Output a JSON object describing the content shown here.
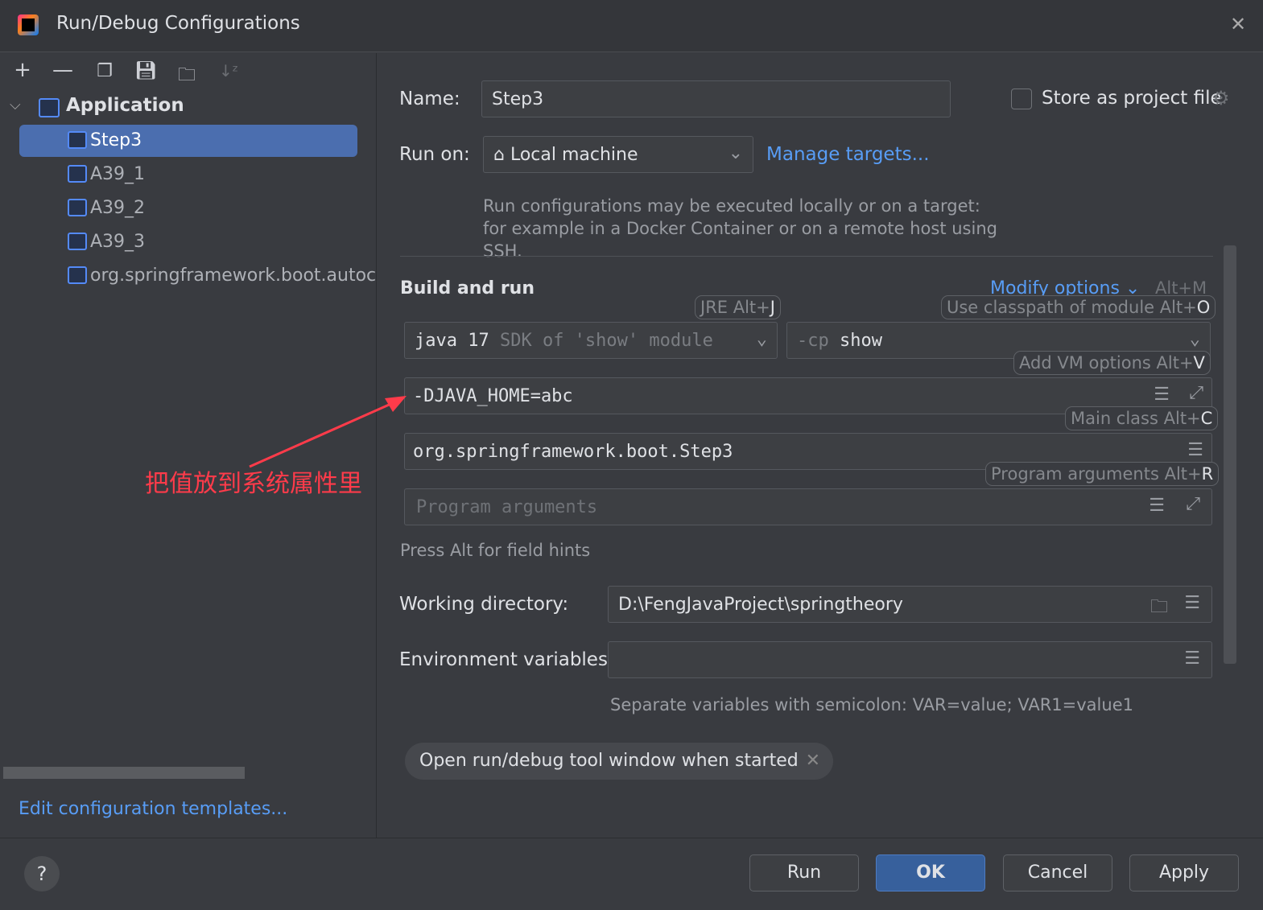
{
  "window": {
    "title": "Run/Debug Configurations",
    "close_icon": "close-icon"
  },
  "toolbar": {
    "icons": [
      "add-icon",
      "remove-icon",
      "copy-icon",
      "save-icon",
      "new-folder-icon",
      "sort-icon"
    ]
  },
  "tree": {
    "group": "Application",
    "items": [
      {
        "label": "Step3",
        "selected": true
      },
      {
        "label": "A39_1"
      },
      {
        "label": "A39_2"
      },
      {
        "label": "A39_3"
      },
      {
        "label": "org.springframework.boot.autoco"
      }
    ]
  },
  "edit_templates": "Edit configuration templates...",
  "form": {
    "name_label": "Name:",
    "name_value": "Step3",
    "store_label": "Store as project file",
    "run_on_label": "Run on:",
    "run_on_value": "Local machine",
    "manage_targets": "Manage targets...",
    "run_on_help": "Run configurations may be executed locally or on a target: for example in a Docker Container or on a remote host using SSH.",
    "section": "Build and run",
    "modify_options": "Modify options",
    "modify_shortcut": "Alt+M",
    "jre_value": "java 17",
    "jre_hint": "SDK of 'show' module",
    "cp_prefix": "-cp",
    "cp_value": "show",
    "vm_options": "-DJAVA_HOME=abc",
    "main_class": "org.springframework.boot.Step3",
    "program_args_placeholder": "Program arguments",
    "alt_hint": "Press Alt for field hints",
    "workdir_label": "Working directory:",
    "workdir_value": "D:\\FengJavaProject\\springtheory",
    "env_label": "Environment variables:",
    "env_value": "",
    "env_help": "Separate variables with semicolon: VAR=value; VAR1=value1",
    "chip": "Open run/debug tool window when started"
  },
  "pills": {
    "jre": [
      "JRE Alt+",
      "J"
    ],
    "cp": [
      "Use classpath of module Alt+",
      "O"
    ],
    "vm": [
      "Add VM options Alt+",
      "V"
    ],
    "main": [
      "Main class Alt+",
      "C"
    ],
    "args": [
      "Program arguments Alt+",
      "R"
    ]
  },
  "annotation": "把值放到系统属性里",
  "annotation_color": "#ff3b4a",
  "buttons": {
    "run": "Run",
    "ok": "OK",
    "cancel": "Cancel",
    "apply": "Apply",
    "help": "?"
  }
}
